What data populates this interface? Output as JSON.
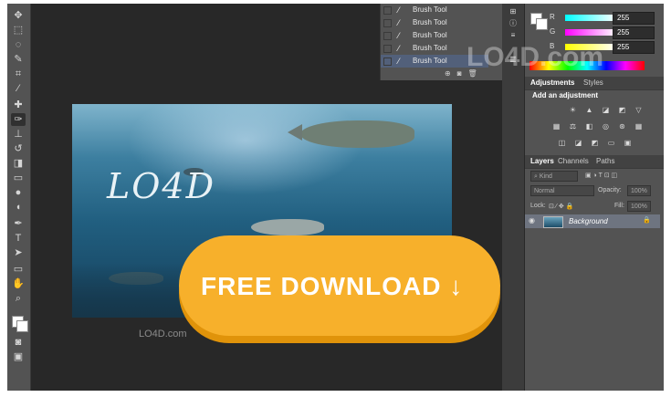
{
  "toolbar": {
    "tools": [
      "move-icon",
      "marquee-icon",
      "lasso-icon",
      "quick-select-icon",
      "crop-icon",
      "eyedropper-icon",
      "healing-icon",
      "brush-icon",
      "stamp-icon",
      "history-brush-icon",
      "eraser-icon",
      "gradient-icon",
      "blur-icon",
      "dodge-icon",
      "pen-icon",
      "type-icon",
      "path-select-icon",
      "shape-icon",
      "hand-icon",
      "zoom-icon"
    ],
    "type_glyph": "T"
  },
  "history": {
    "items": [
      {
        "label": "Brush Tool",
        "active": false
      },
      {
        "label": "Brush Tool",
        "active": false
      },
      {
        "label": "Brush Tool",
        "active": false
      },
      {
        "label": "Brush Tool",
        "active": false
      },
      {
        "label": "Brush Tool",
        "active": true
      }
    ]
  },
  "color": {
    "r_label": "R",
    "g_label": "G",
    "b_label": "B",
    "r_value": "255",
    "g_value": "255",
    "b_value": "255"
  },
  "adjustments": {
    "tab_adjustments": "Adjustments",
    "tab_styles": "Styles",
    "heading": "Add an adjustment"
  },
  "layers": {
    "tab_layers": "Layers",
    "tab_channels": "Channels",
    "tab_paths": "Paths",
    "kind_label": "Kind",
    "blend_mode": "Normal",
    "opacity_label": "Opacity:",
    "opacity_value": "100%",
    "lock_label": "Lock:",
    "fill_label": "Fill:",
    "fill_value": "100%",
    "layer_name": "Background"
  },
  "canvas": {
    "handwriting": "LO4D"
  },
  "banner": {
    "download_label": "FREE DOWNLOAD ↓"
  },
  "watermark": {
    "text": "LO4D.com"
  }
}
